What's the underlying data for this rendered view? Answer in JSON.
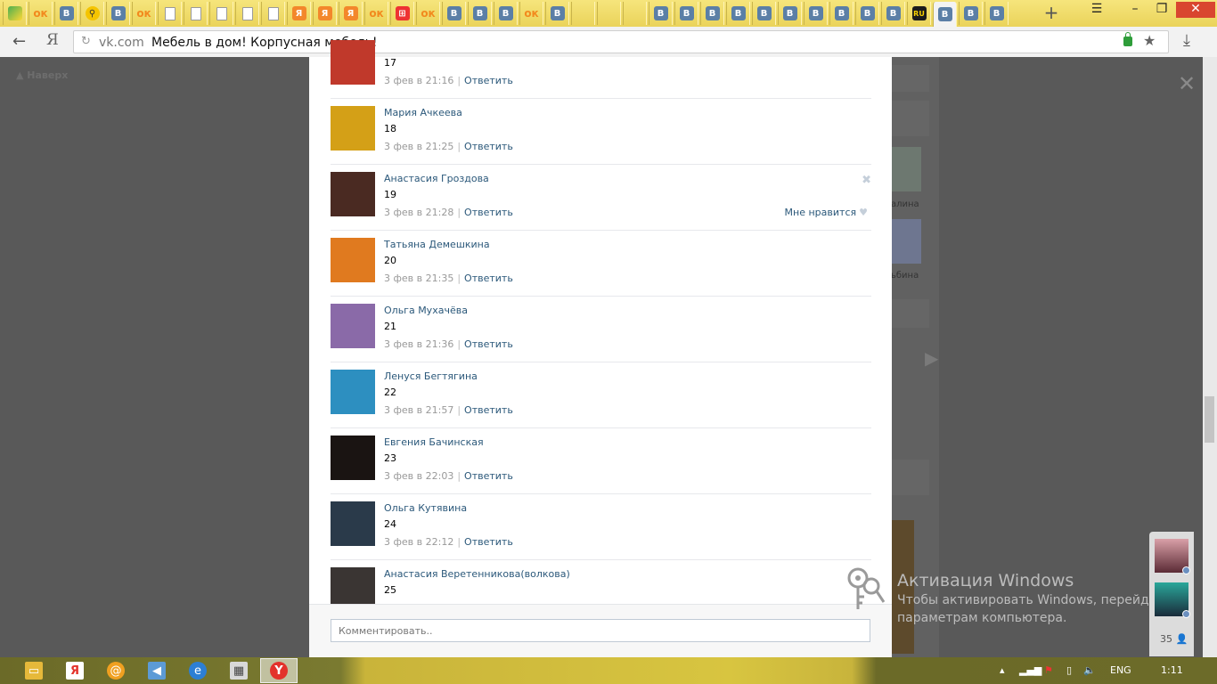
{
  "browser": {
    "domain": "vk.com",
    "page_title": "Мебель в дом! Корпусная мебель!",
    "new_tab_label": "+",
    "ya_label": "Я",
    "tabs": [
      {
        "icon": "map-icon",
        "kind": "map",
        "label": ""
      },
      {
        "icon": "ok-icon",
        "kind": "ok",
        "label": "ок"
      },
      {
        "icon": "vk-icon",
        "kind": "vk",
        "label": "B"
      },
      {
        "icon": "search-icon",
        "kind": "search",
        "label": "⚲"
      },
      {
        "icon": "vk-icon",
        "kind": "vk",
        "label": "B"
      },
      {
        "icon": "ok-icon",
        "kind": "ok",
        "label": "ок"
      },
      {
        "icon": "document-icon",
        "kind": "doc",
        "label": ""
      },
      {
        "icon": "document-icon",
        "kind": "doc",
        "label": ""
      },
      {
        "icon": "document-icon",
        "kind": "doc",
        "label": ""
      },
      {
        "icon": "document-icon",
        "kind": "doc",
        "label": ""
      },
      {
        "icon": "document-icon",
        "kind": "doc",
        "label": ""
      },
      {
        "icon": "yandex-direct-icon",
        "kind": "yd",
        "label": "Я"
      },
      {
        "icon": "yandex-direct-icon",
        "kind": "yd",
        "label": "Я"
      },
      {
        "icon": "yandex-direct-icon",
        "kind": "yd",
        "label": "Я"
      },
      {
        "icon": "ok-icon",
        "kind": "ok",
        "label": "ок"
      },
      {
        "icon": "cart-icon",
        "kind": "cart",
        "label": "⊞"
      },
      {
        "icon": "ok-icon",
        "kind": "ok",
        "label": "ок"
      },
      {
        "icon": "vk-icon",
        "kind": "vk",
        "label": "B"
      },
      {
        "icon": "vk-icon",
        "kind": "vk",
        "label": "B"
      },
      {
        "icon": "vk-icon",
        "kind": "vk",
        "label": "B"
      },
      {
        "icon": "ok-icon",
        "kind": "ok",
        "label": "ок"
      },
      {
        "icon": "vk-icon",
        "kind": "vk",
        "label": "B"
      },
      {
        "icon": "dots-icon",
        "kind": "dots",
        "label": ""
      },
      {
        "icon": "dots-icon",
        "kind": "dots",
        "label": ""
      },
      {
        "icon": "dots-icon",
        "kind": "dots",
        "label": ""
      },
      {
        "icon": "vk-icon",
        "kind": "vk",
        "label": "B"
      },
      {
        "icon": "vk-icon",
        "kind": "vk",
        "label": "B"
      },
      {
        "icon": "vk-icon",
        "kind": "vk",
        "label": "B"
      },
      {
        "icon": "vk-icon",
        "kind": "vk",
        "label": "B"
      },
      {
        "icon": "vk-icon",
        "kind": "vk",
        "label": "B"
      },
      {
        "icon": "vk-icon",
        "kind": "vk",
        "label": "B"
      },
      {
        "icon": "vk-icon",
        "kind": "vk",
        "label": "B"
      },
      {
        "icon": "vk-icon",
        "kind": "vk",
        "label": "B"
      },
      {
        "icon": "vk-icon",
        "kind": "vk",
        "label": "B"
      },
      {
        "icon": "vk-icon",
        "kind": "vk",
        "label": "B"
      },
      {
        "icon": "ru-icon",
        "kind": "ru",
        "label": "RU"
      },
      {
        "icon": "vk-icon",
        "kind": "vk",
        "label": "B",
        "active": true
      },
      {
        "icon": "vk-icon",
        "kind": "vk",
        "label": "B"
      },
      {
        "icon": "vk-icon",
        "kind": "vk",
        "label": "B"
      }
    ]
  },
  "page": {
    "back_to_top": "Наверх",
    "right_col": {
      "text1": "алина",
      "text2": "ьбина"
    }
  },
  "comments": [
    {
      "author": "",
      "text": "17",
      "date": "3 фев в 21:16",
      "reply": "Ответить",
      "avatar": "#c0392b"
    },
    {
      "author": "Мария Ачкеева",
      "text": "18",
      "date": "3 фев в 21:25",
      "reply": "Ответить",
      "avatar": "#d4a017"
    },
    {
      "author": "Анастасия Гроздова",
      "text": "19",
      "date": "3 фев в 21:28",
      "reply": "Ответить",
      "avatar": "#4a2a22",
      "like": "Мне нравится",
      "delete": "✖"
    },
    {
      "author": "Татьяна Демешкина",
      "text": "20",
      "date": "3 фев в 21:35",
      "reply": "Ответить",
      "avatar": "#e07a1f"
    },
    {
      "author": "Ольга Мухачёва",
      "text": "21",
      "date": "3 фев в 21:36",
      "reply": "Ответить",
      "avatar": "#8a6aa8"
    },
    {
      "author": "Ленуся Бегтягина",
      "text": "22",
      "date": "3 фев в 21:57",
      "reply": "Ответить",
      "avatar": "#2d8fc0"
    },
    {
      "author": "Евгения Бачинская",
      "text": "23",
      "date": "3 фев в 22:03",
      "reply": "Ответить",
      "avatar": "#1a1412"
    },
    {
      "author": "Ольга Кутявина",
      "text": "24",
      "date": "3 фев в 22:12",
      "reply": "Ответить",
      "avatar": "#2a3a4a"
    },
    {
      "author": "Анастасия Веретенникова(волкова)",
      "text": "25",
      "date": "",
      "reply": "",
      "avatar": "#3a3533"
    }
  ],
  "comment_input": {
    "placeholder": "Комментировать.."
  },
  "watermark": {
    "title": "Активация Windows",
    "line1": "Чтобы активировать Windows, перейдите к",
    "line2": "параметрам компьютера."
  },
  "chat": {
    "count": "35"
  },
  "taskbar": {
    "lang": "ENG",
    "time": "1:11"
  }
}
